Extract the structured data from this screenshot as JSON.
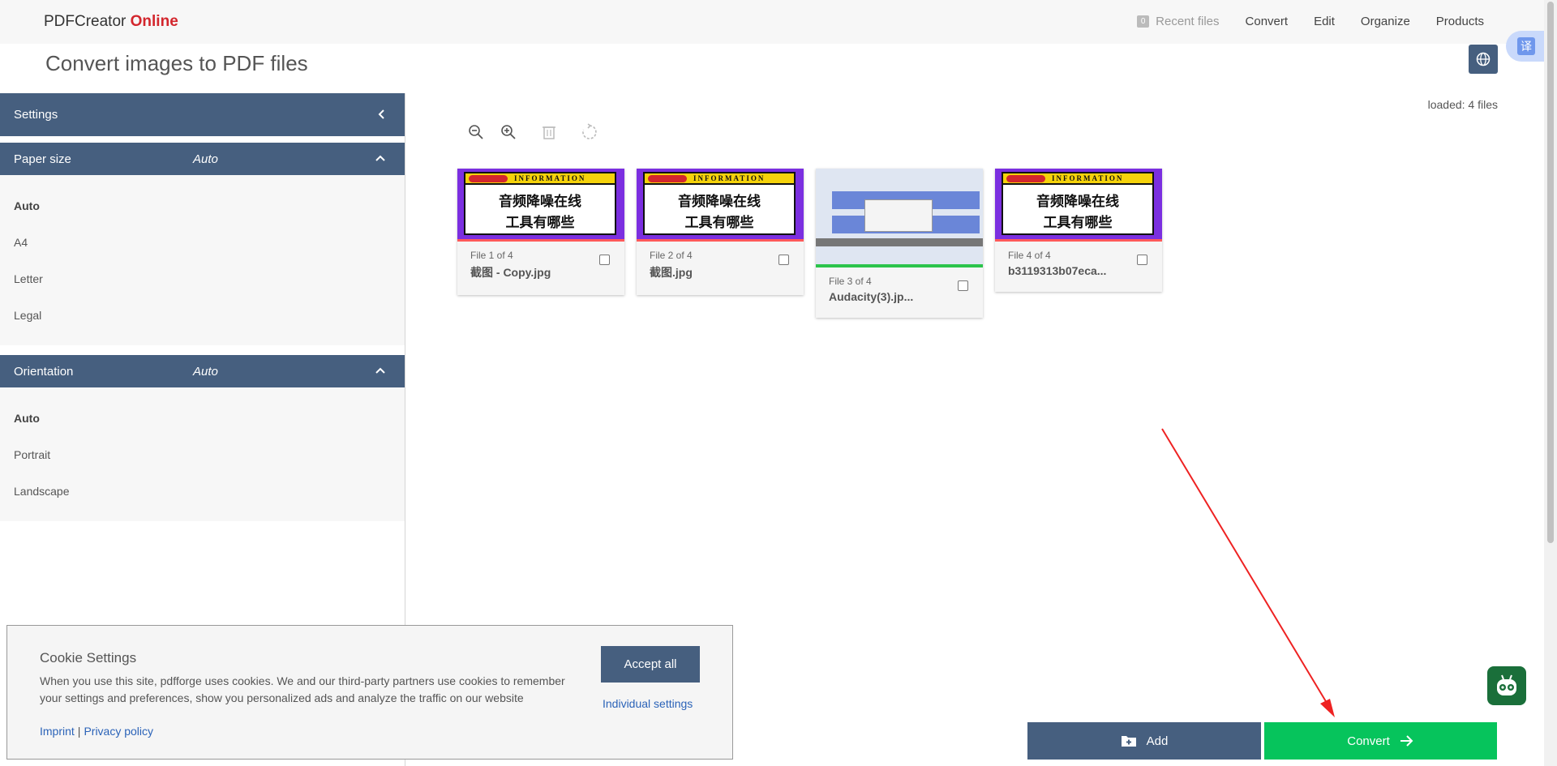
{
  "header": {
    "logo_main": "PDFCreator",
    "logo_accent": "Online",
    "recent_badge": "0",
    "nav": [
      "Recent files",
      "Convert",
      "Edit",
      "Organize",
      "Products"
    ]
  },
  "page": {
    "title": "Convert images to PDF files",
    "translate_label": "译"
  },
  "settings": {
    "title": "Settings",
    "paper_size": {
      "label": "Paper size",
      "value": "Auto",
      "options": [
        "Auto",
        "A4",
        "Letter",
        "Legal"
      ]
    },
    "orientation": {
      "label": "Orientation",
      "value": "Auto",
      "options": [
        "Auto",
        "Portrait",
        "Landscape"
      ]
    }
  },
  "main": {
    "loaded": "loaded: 4 files",
    "files": [
      {
        "num": "File 1 of 4",
        "name": "截图 - Copy.jpg",
        "preview_title": "INFORMATION",
        "preview_line1": "音频降噪在线",
        "preview_line2": "工具有哪些"
      },
      {
        "num": "File 2 of 4",
        "name": "截图.jpg",
        "preview_title": "INFORMATION",
        "preview_line1": "音频降噪在线",
        "preview_line2": "工具有哪些"
      },
      {
        "num": "File 3 of 4",
        "name": "Audacity(3).jp..."
      },
      {
        "num": "File 4 of 4",
        "name": "b3119313b07eca...",
        "preview_title": "INFORMATION",
        "preview_line1": "音频降噪在线",
        "preview_line2": "工具有哪些"
      }
    ]
  },
  "cookie": {
    "title": "Cookie Settings",
    "text": "When you use this site, pdfforge uses cookies. We and our third-party partners use cookies to remember your settings and preferences, show you personalized ads and analyze the traffic on our website",
    "imprint": "Imprint",
    "separator": "|",
    "privacy": "Privacy policy",
    "accept": "Accept all",
    "individual": "Individual settings"
  },
  "actions": {
    "add": "Add",
    "convert": "Convert"
  },
  "colors": {
    "primary": "#465f7f",
    "accent_red": "#d3262d",
    "convert_green": "#06c45c"
  }
}
